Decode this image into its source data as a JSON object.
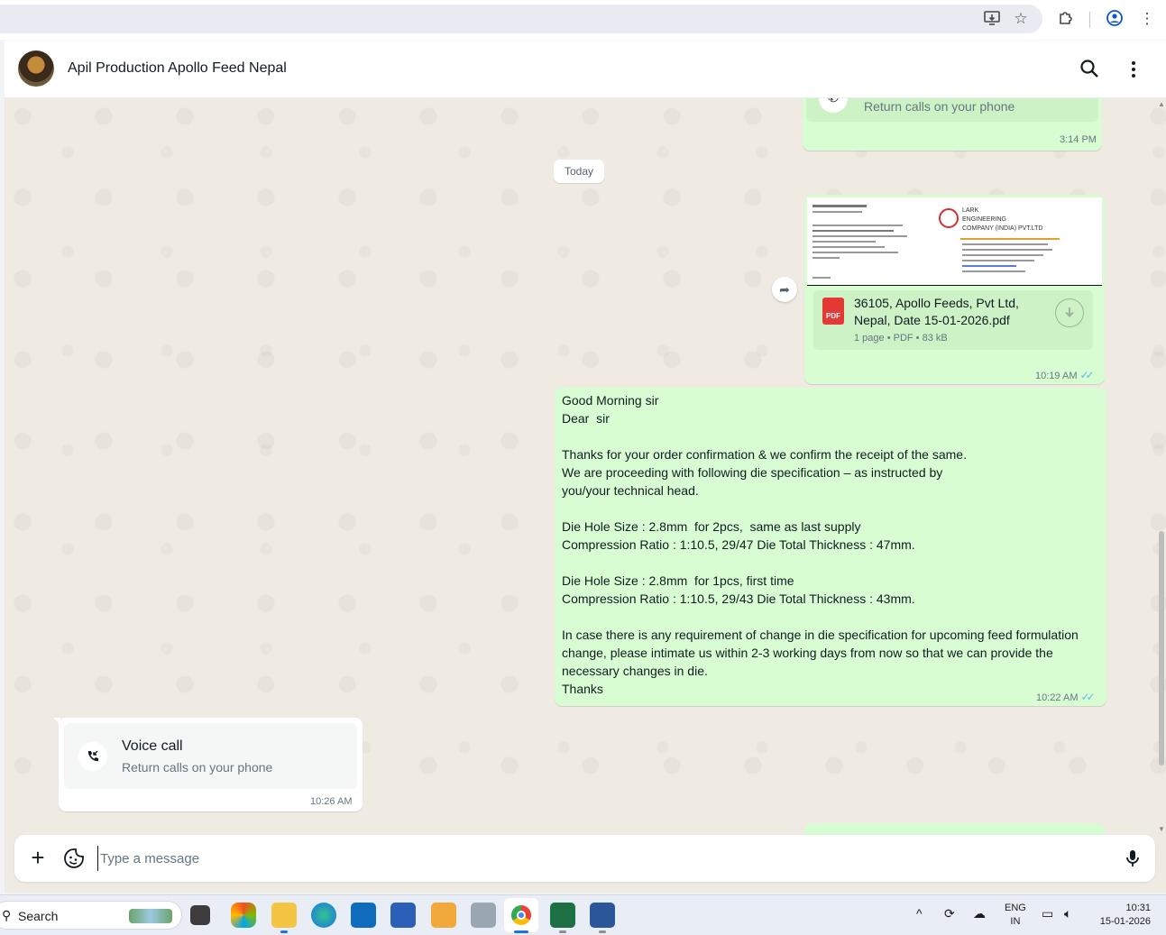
{
  "chat": {
    "title": "Apil Production Apollo Feed Nepal",
    "date_chip": "Today"
  },
  "previous_call": {
    "subtitle": "Return calls on your phone",
    "time": "3:14 PM"
  },
  "document": {
    "name_line1": "36105, Apollo Feeds, Pvt Ltd,",
    "name_line2": "Nepal, Date 15-01-2026.pdf",
    "meta": "1 page • PDF • 83 kB",
    "icon_label": "PDF",
    "time": "10:19 AM",
    "preview": {
      "company_line1": "LARK",
      "company_line2": "ENGINEERING",
      "company_line3": "COMPANY (INDIA) PVT.LTD"
    }
  },
  "text_message": {
    "lines": [
      "Good Morning sir",
      "Dear  sir",
      "",
      "Thanks for your order confirmation & we confirm the receipt of the same.",
      "We are proceeding with following die specification – as instructed by",
      "you/your technical head.",
      "",
      "Die Hole Size : 2.8mm  for 2pcs,  same as last supply",
      "Compression Ratio : 1:10.5, 29/47 Die Total Thickness : 47mm.",
      "",
      "Die Hole Size : 2.8mm  for 1pcs, first time",
      "Compression Ratio : 1:10.5, 29/43 Die Total Thickness : 43mm.",
      "",
      "In case there is any requirement of change in die specification for upcoming feed formulation",
      "change, please intimate us within 2-3 working days from now so that we can provide the",
      "necessary changes in die.",
      "Thanks"
    ],
    "time": "10:22 AM"
  },
  "voice_call": {
    "title": "Voice call",
    "subtitle": "Return calls on your phone",
    "time": "10:26 AM"
  },
  "compose": {
    "placeholder": "Type a message"
  },
  "taskbar": {
    "search_label": "Search",
    "lang_line1": "ENG",
    "lang_line2": "IN",
    "clock_time": "10:31",
    "clock_date": "15-01-2026"
  },
  "colors": {
    "outgoing_bubble": "#d9fdd3",
    "incoming_bubble": "#ffffff",
    "wallpaper": "#efeae2",
    "read_ticks": "#53bdeb"
  }
}
